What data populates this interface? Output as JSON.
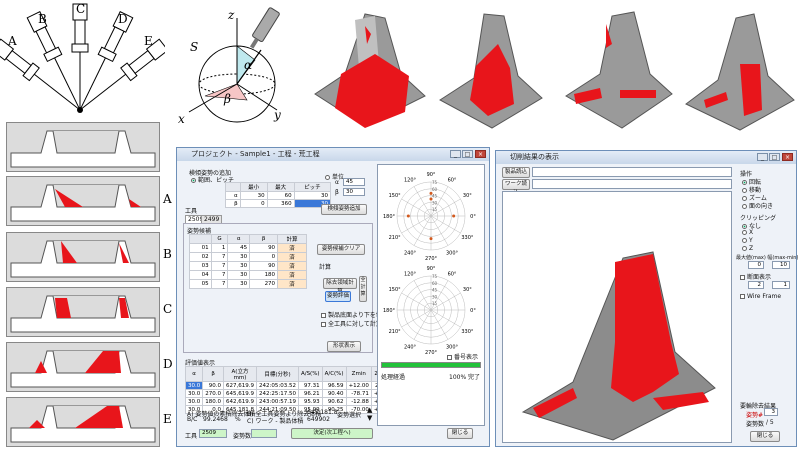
{
  "figure_labels": {
    "A": "A",
    "B": "B",
    "C": "C",
    "D": "D",
    "E": "E",
    "S": "S",
    "alpha": "α",
    "beta": "β",
    "x": "x",
    "y": "y",
    "z": "z"
  },
  "section_labels": [
    "A",
    "B",
    "C",
    "D",
    "E"
  ],
  "main_window": {
    "title": "プロジェクト - Sample1 - 工程 - 荒工程",
    "group_title": "検傾姿勢の追加",
    "radio_range": "範囲、ピッチ",
    "radio_single": "単位",
    "range_headers": [
      "",
      "最小",
      "最大",
      "ピッチ"
    ],
    "range_rows": [
      {
        "sym": "α",
        "min": "30",
        "max": "60",
        "pitch": "30"
      },
      {
        "sym": "β",
        "min": "0",
        "max": "360",
        "pitch": "30"
      }
    ],
    "single_alpha": "45",
    "single_beta": "30",
    "add_btn": "検傾姿勢追加",
    "tool_label": "工具",
    "tabs": [
      "2509",
      "2499"
    ],
    "candidates_label": "姿勢候補",
    "cand_headers": [
      "",
      "G",
      "α",
      "β",
      "計算"
    ],
    "cand_rows": [
      {
        "id": "01",
        "g": "1",
        "a": "45",
        "b": "90",
        "calc": "済"
      },
      {
        "id": "02",
        "g": "7",
        "a": "30",
        "b": "0",
        "calc": "済"
      },
      {
        "id": "03",
        "g": "7",
        "a": "30",
        "b": "90",
        "calc": "済"
      },
      {
        "id": "04",
        "g": "7",
        "a": "30",
        "b": "180",
        "calc": "済"
      },
      {
        "id": "05",
        "g": "7",
        "a": "30",
        "b": "270",
        "calc": "済"
      }
    ],
    "clear_btn": "姿勢候補クリア",
    "calc_label": "計算",
    "calc_area_btn": "除去領域計算",
    "eval_btn": "姿勢評価",
    "calc_all_btn": "全計算",
    "chk1": "製品底面より下を切削",
    "chk2": "全工具に対して計算",
    "result_show_btn": "形状表示",
    "eval_title": "評価値表示",
    "eval_headers": [
      "α",
      "β",
      "A(立方mm)",
      "目標(分秒)",
      "A/S(%)",
      "A/C(%)",
      "Zmin",
      "Zmax"
    ],
    "eval_rows": [
      [
        "30.0",
        "90.0",
        "627,619.9",
        "242:05:03.52",
        "97.31",
        "96.59",
        "+12.00",
        "22.24"
      ],
      [
        "30.0",
        "270.0",
        "645,619.9",
        "242:25:17.50",
        "96.21",
        "90.40",
        "-78.71",
        "+9.62"
      ],
      [
        "30.0",
        "180.0",
        "642,619.9",
        "243:00:57.19",
        "95.93",
        "90.62",
        "-12.88",
        "+7.51"
      ],
      [
        "30.0",
        "0.0",
        "645,181.8",
        "244:21:09.50",
        "95.99",
        "90.25",
        "-70.00",
        "+20.0"
      ]
    ],
    "sum_a": "A) 姿勢値の素積除去体積",
    "sum_b": "B) 全工具姿勢より除去体積",
    "sum_a_val": "645,181.8",
    "sum_c": "C) ワーク - 製品体積",
    "sum_bc": "B/C",
    "sum_bc_val": "99.2468",
    "sum_pct": "%",
    "sum_c_val": "649902",
    "select_label": "姿勢選択",
    "tool_footer": "工具",
    "tool_val": "2509",
    "pos_footer": "姿勢数",
    "pos_val": "",
    "decide_btn": "決定(次工程へ)",
    "close_btn": "閉じる",
    "polar_angles": [
      "90°",
      "120°",
      "150°",
      "180°",
      "210°",
      "240°",
      "270°",
      "300°",
      "330°",
      "0°",
      "30°",
      "60°"
    ],
    "polar_ring_labels": [
      "75",
      "60",
      "45",
      "30",
      "15"
    ],
    "number_check": "番号表示",
    "progress_label": "処理経過",
    "progress_text": "100% 完了",
    "progress": 1.0
  },
  "viewer_window": {
    "title": "切削結果の表示",
    "product_btn": "製品読込",
    "work_btn": "ワーク読込",
    "op_label": "操作",
    "ops": [
      "回転",
      "移動",
      "ズーム",
      "面の向き"
    ],
    "clip_label": "クリッピング",
    "clips": [
      "なし",
      "X",
      "Y",
      "Z"
    ],
    "maxmin_label": "最大値(max) 幅(max-min)",
    "max_val": "0",
    "width_val": "10",
    "section_chk": "断面表示",
    "sec_a": "2",
    "sec_b": "1",
    "wire_chk": "Wire Frame",
    "result_label": "要輪除去結果",
    "pos_label": "姿勢#",
    "pos_value": "3",
    "pos_count_label": "姿勢数",
    "pos_count": "/ 5",
    "close_btn": "閉じる"
  },
  "colors": {
    "red": "#e8151b",
    "gray": "#8a8a8a",
    "window": "#eef2f8"
  }
}
